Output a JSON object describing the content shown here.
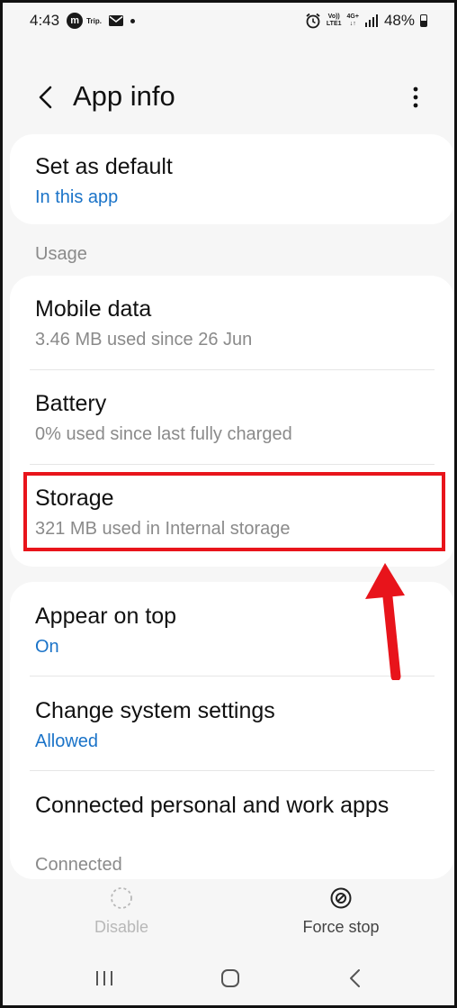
{
  "status_bar": {
    "time": "4:43",
    "notif_m": "m",
    "notif_trip": "Trip.",
    "volte_top": "Vo))",
    "volte_bottom": "LTE1",
    "network": "4G+",
    "battery": "48%",
    "battery_level": 0.48
  },
  "header": {
    "title": "App info"
  },
  "default_card": {
    "title": "Set as default",
    "subtitle": "In this app"
  },
  "usage": {
    "section_label": "Usage",
    "items": [
      {
        "title": "Mobile data",
        "subtitle": "3.46 MB used since 26 Jun"
      },
      {
        "title": "Battery",
        "subtitle": "0% used since last fully charged"
      },
      {
        "title": "Storage",
        "subtitle": "321 MB used in Internal storage"
      }
    ]
  },
  "permissions": {
    "items": [
      {
        "title": "Appear on top",
        "subtitle": "On"
      },
      {
        "title": "Change system settings",
        "subtitle": "Allowed"
      },
      {
        "title": "Connected personal and work apps",
        "subtitle": "Connected"
      }
    ]
  },
  "bottom_actions": {
    "disable": "Disable",
    "force_stop": "Force stop"
  },
  "colors": {
    "accent_blue": "#1a73c8",
    "highlight_red": "#e8141b",
    "background": "#f6f6f6"
  }
}
